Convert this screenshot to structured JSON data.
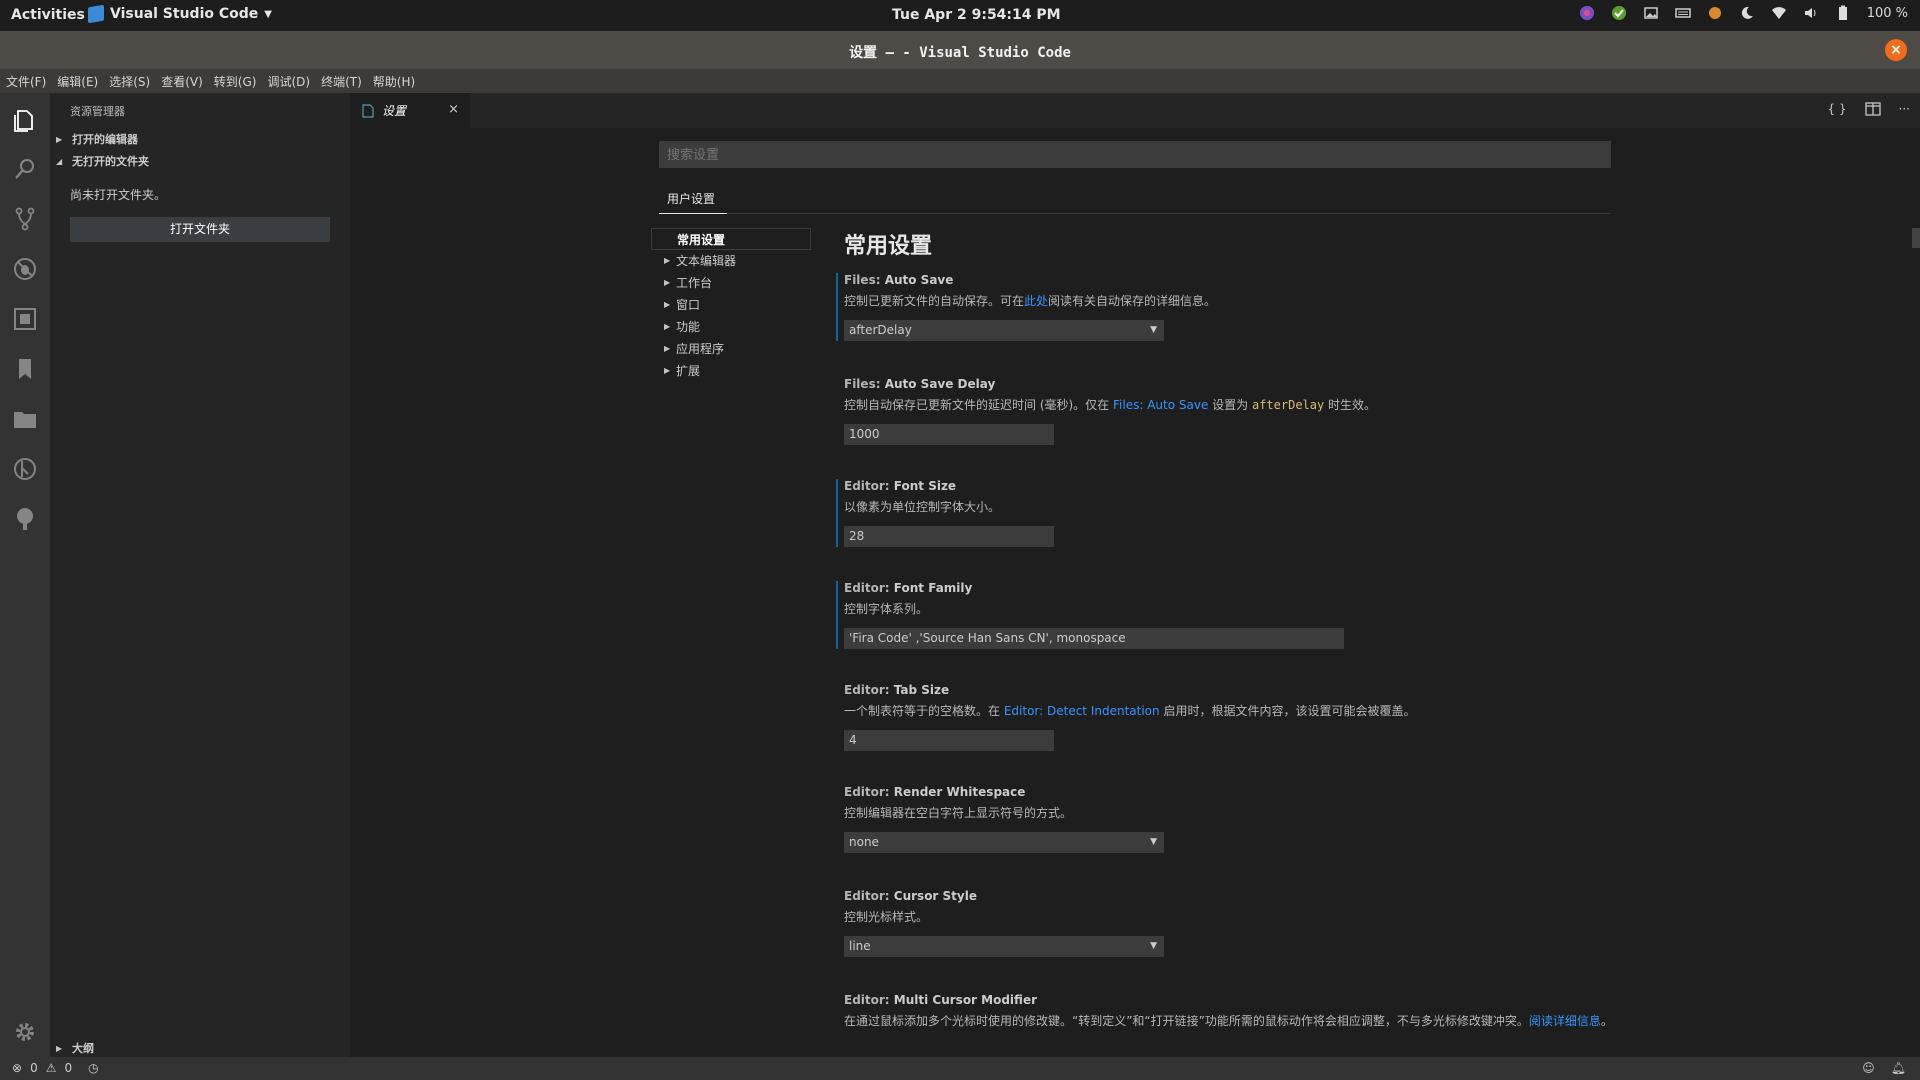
{
  "topbar": {
    "activities": "Activities",
    "app_name": "Visual Studio Code",
    "clock": "Tue Apr 2   9:54:14 PM",
    "battery": "100 %"
  },
  "window": {
    "title": "设置 — - Visual Studio Code"
  },
  "menu": [
    "文件(F)",
    "编辑(E)",
    "选择(S)",
    "查看(V)",
    "转到(G)",
    "调试(D)",
    "终端(T)",
    "帮助(H)"
  ],
  "sidebar": {
    "title": "资源管理器",
    "open_editors": "打开的编辑器",
    "no_folder_section": "无打开的文件夹",
    "no_folder_msg": "尚未打开文件夹。",
    "open_folder_button": "打开文件夹",
    "outline": "大纲"
  },
  "tab": {
    "label": "设置",
    "close": "×"
  },
  "settings": {
    "search_placeholder": "搜索设置",
    "user_tab": "用户设置",
    "toc": [
      {
        "label": "常用设置",
        "active": true
      },
      {
        "label": "文本编辑器"
      },
      {
        "label": "工作台"
      },
      {
        "label": "窗口"
      },
      {
        "label": "功能"
      },
      {
        "label": "应用程序"
      },
      {
        "label": "扩展"
      }
    ],
    "section_title": "常用设置",
    "items": {
      "auto_save": {
        "cat": "Files: ",
        "name": "Auto Save",
        "desc_a": "控制已更新文件的自动保存。可在",
        "desc_link": "此处",
        "desc_b": "阅读有关自动保存的详细信息。",
        "value": "afterDelay"
      },
      "auto_save_delay": {
        "cat": "Files: ",
        "name": "Auto Save Delay",
        "desc_a": "控制自动保存已更新文件的延迟时间 (毫秒)。仅在 ",
        "desc_link": "Files: Auto Save",
        "desc_b": " 设置为 ",
        "desc_code": "afterDelay",
        "desc_c": " 时生效。",
        "value": "1000"
      },
      "font_size": {
        "cat": "Editor: ",
        "name": "Font Size",
        "desc": "以像素为单位控制字体大小。",
        "value": "28"
      },
      "font_family": {
        "cat": "Editor: ",
        "name": "Font Family",
        "desc": "控制字体系列。",
        "value": " 'Fira Code' ,'Source Han Sans CN', monospace"
      },
      "tab_size": {
        "cat": "Editor: ",
        "name": "Tab Size",
        "desc_a": "一个制表符等于的空格数。在 ",
        "desc_link": "Editor: Detect Indentation",
        "desc_b": " 启用时，根据文件内容，该设置可能会被覆盖。",
        "value": "4"
      },
      "render_whitespace": {
        "cat": "Editor: ",
        "name": "Render Whitespace",
        "desc": "控制编辑器在空白字符上显示符号的方式。",
        "value": "none"
      },
      "cursor_style": {
        "cat": "Editor: ",
        "name": "Cursor Style",
        "desc": "控制光标样式。",
        "value": "line"
      },
      "multi_cursor": {
        "cat": "Editor: ",
        "name": "Multi Cursor Modifier",
        "desc_a": "在通过鼠标添加多个光标时使用的修改键。“转到定义”和“打开链接”功能所需的鼠标动作将会相应调整，不与多光标修改键冲突。",
        "desc_link": "阅读详细信息",
        "desc_b": "。"
      }
    }
  },
  "status": {
    "errors": "0",
    "warnings": "0"
  },
  "colors": {
    "accent": "#0e639c",
    "link": "#3794ff",
    "close_button": "#f06d1b"
  }
}
